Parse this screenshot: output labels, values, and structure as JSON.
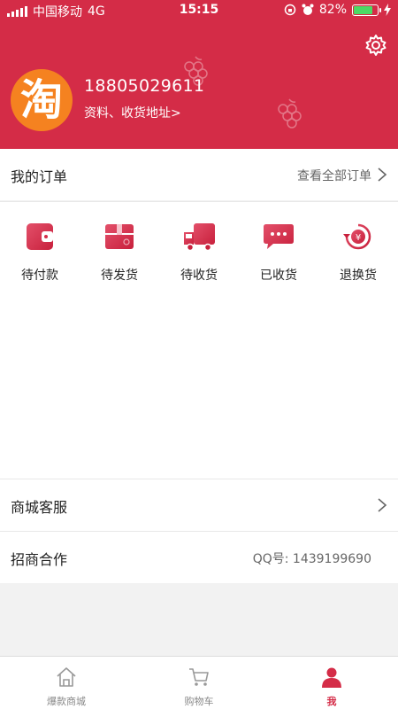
{
  "status_bar": {
    "carrier": "中国移动",
    "network": "4G",
    "time": "15:15",
    "battery": "82%",
    "battery_level": 0.82
  },
  "header": {
    "avatar_text": "淘",
    "phone": "18805029611",
    "profile_link": "资料、收货地址>"
  },
  "orders": {
    "title": "我的订单",
    "view_all": "查看全部订单",
    "items": [
      {
        "label": "待付款",
        "icon": "wallet-icon"
      },
      {
        "label": "待发货",
        "icon": "package-icon"
      },
      {
        "label": "待收货",
        "icon": "truck-icon"
      },
      {
        "label": "已收货",
        "icon": "chat-bubble-icon"
      },
      {
        "label": "退换货",
        "icon": "refund-icon"
      }
    ]
  },
  "service": {
    "label": "商城客服"
  },
  "partner": {
    "label": "招商合作",
    "value": "QQ号: 1439199690"
  },
  "tabs": [
    {
      "label": "爆款商城",
      "icon": "home-icon",
      "active": false
    },
    {
      "label": "购物车",
      "icon": "cart-icon",
      "active": false
    },
    {
      "label": "我",
      "icon": "person-icon",
      "active": true
    }
  ],
  "colors": {
    "brand": "#d42c47",
    "avatar": "#f58220"
  }
}
